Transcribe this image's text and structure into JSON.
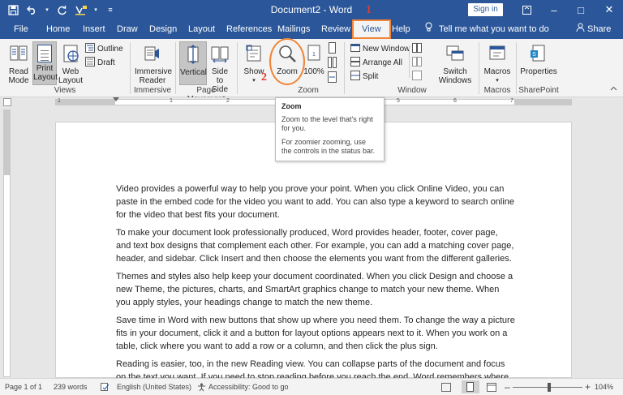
{
  "titlebar": {
    "doc_title": "Document2  -  Word",
    "signin": "Sign in",
    "qat": {
      "save": "save-icon",
      "undo": "undo-icon",
      "redo": "redo-icon",
      "format": "format-painter-icon",
      "more": "customize-icon"
    },
    "controls": {
      "options": "□",
      "minimize": "–",
      "maximize": "□",
      "close": "✕"
    }
  },
  "annotations": {
    "step1": "1",
    "step2": "2"
  },
  "tabs": [
    "File",
    "Home",
    "Insert",
    "Draw",
    "Design",
    "Layout",
    "References",
    "Mailings",
    "Review",
    "View",
    "Help"
  ],
  "active_tab": "View",
  "tell_me": "Tell me what you want to do",
  "share": "Share",
  "ribbon": {
    "views": {
      "read_mode": "Read Mode",
      "print_layout": "Print Layout",
      "web_layout": "Web Layout",
      "outline": "Outline",
      "draft": "Draft",
      "label": "Views"
    },
    "immersive": {
      "reader": "Immersive Reader",
      "label": "Immersive"
    },
    "page_movement": {
      "vertical": "Vertical",
      "side_to_side": "Side to Side",
      "label": "Page Movement"
    },
    "show": {
      "label": "Show"
    },
    "zoom": {
      "zoom": "Zoom",
      "hundred": "100%",
      "label": "Zoom"
    },
    "window": {
      "new_window": "New Window",
      "arrange_all": "Arrange All",
      "split": "Split",
      "switch_windows": "Switch Windows",
      "label": "Window"
    },
    "macros": {
      "macros": "Macros",
      "label": "Macros"
    },
    "sharepoint": {
      "properties": "Properties",
      "label": "SharePoint"
    }
  },
  "tooltip": {
    "title": "Zoom",
    "line1": "Zoom to the level that's right for you.",
    "line2": "For zoomier zooming, use the controls in the status bar."
  },
  "document": {
    "paragraphs": [
      "Video provides a powerful way to help you prove your point. When you click Online Video, you can paste in the embed code for the video you want to add. You can also type a keyword to search online for the video that best fits your document.",
      "To make your document look professionally produced, Word provides header, footer, cover page, and text box designs that complement each other. For example, you can add a matching cover page, header, and sidebar. Click Insert and then choose the elements you want from the different galleries.",
      "Themes and styles also help keep your document coordinated. When you click Design and choose a new Theme, the pictures, charts, and SmartArt graphics change to match your new theme. When you apply styles, your headings change to match the new theme.",
      "Save time in Word with new buttons that show up where you need them. To change the way a picture fits in your document, click it and a button for layout options appears next to it. When you work on a table, click where you want to add a row or a column, and then click the plus sign.",
      "Reading is easier, too, in the new Reading view. You can collapse parts of the document and focus on the text you want. If you need to stop reading before you reach the end, Word remembers where you"
    ]
  },
  "status": {
    "page": "Page 1 of 1",
    "words": "239 words",
    "language": "English (United States)",
    "accessibility": "Accessibility: Good to go",
    "zoom_minus": "–",
    "zoom_plus": "+",
    "zoom_level": "104%",
    "zoom_fraction": 0.52
  },
  "ruler": {
    "numbers": [
      "1",
      "1",
      "2",
      "3",
      "4",
      "5",
      "6",
      "7"
    ]
  }
}
